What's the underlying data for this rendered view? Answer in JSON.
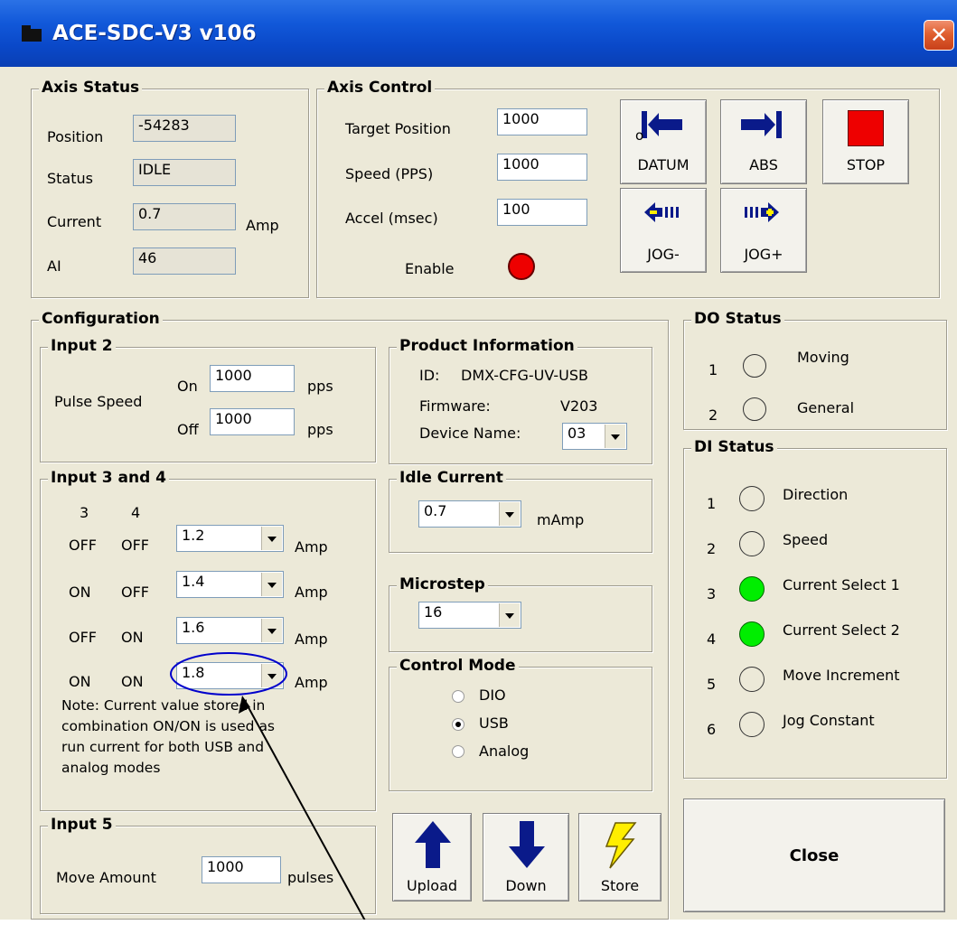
{
  "window": {
    "title": "ACE-SDC-V3 v106",
    "close_glyph": "✕"
  },
  "axis_status": {
    "title": "Axis Status",
    "position_label": "Position",
    "position_value": "-54283",
    "status_label": "Status",
    "status_value": "IDLE",
    "current_label": "Current",
    "current_value": "0.7",
    "current_unit": "Amp",
    "ai_label": "AI",
    "ai_value": "46"
  },
  "axis_control": {
    "title": "Axis Control",
    "target_label": "Target Position",
    "target_value": "1000",
    "speed_label": "Speed (PPS)",
    "speed_value": "1000",
    "accel_label": "Accel (msec)",
    "accel_value": "100",
    "enable_label": "Enable",
    "enable_color": "#ee0000",
    "datum_label": "DATUM",
    "datum_mark": "o",
    "abs_label": "ABS",
    "stop_label": "STOP",
    "jog_minus_label": "JOG-",
    "jog_plus_label": "JOG+"
  },
  "configuration": {
    "title": "Configuration",
    "input2": {
      "title": "Input 2",
      "pulse_speed_label": "Pulse Speed",
      "on_label": "On",
      "on_value": "1000",
      "on_unit": "pps",
      "off_label": "Off",
      "off_value": "1000",
      "off_unit": "pps"
    },
    "input34": {
      "title": "Input 3 and 4",
      "col3": "3",
      "col4": "4",
      "rows": [
        {
          "s3": "OFF",
          "s4": "OFF",
          "value": "1.2",
          "unit": "Amp"
        },
        {
          "s3": "ON",
          "s4": "OFF",
          "value": "1.4",
          "unit": "Amp"
        },
        {
          "s3": "OFF",
          "s4": "ON",
          "value": "1.6",
          "unit": "Amp"
        },
        {
          "s3": "ON",
          "s4": "ON",
          "value": "1.8",
          "unit": "Amp"
        }
      ],
      "note": [
        "Note: Current value stored in",
        "combination ON/ON is used as",
        "run current for both USB and",
        "analog modes"
      ]
    },
    "input5": {
      "title": "Input 5",
      "move_label": "Move Amount",
      "move_value": "1000",
      "move_unit": "pulses"
    },
    "product": {
      "title": "Product Information",
      "id_label": "ID:",
      "id_value": "DMX-CFG-UV-USB",
      "fw_label": "Firmware:",
      "fw_value": "V203",
      "device_label": "Device Name:",
      "device_value": "03"
    },
    "idle_current": {
      "title": "Idle Current",
      "value": "0.7",
      "unit": "mAmp"
    },
    "microstep": {
      "title": "Microstep",
      "value": "16"
    },
    "control_mode": {
      "title": "Control Mode",
      "options": [
        "DIO",
        "USB",
        "Analog"
      ],
      "selected": "USB"
    },
    "upload_label": "Upload",
    "down_label": "Down",
    "store_label": "Store"
  },
  "do_status": {
    "title": "DO Status",
    "items": [
      {
        "num": "1",
        "label": "Moving",
        "on": false
      },
      {
        "num": "2",
        "label": "General",
        "on": false
      }
    ]
  },
  "di_status": {
    "title": "DI Status",
    "items": [
      {
        "num": "1",
        "label": "Direction",
        "on": false
      },
      {
        "num": "2",
        "label": "Speed",
        "on": false
      },
      {
        "num": "3",
        "label": "Current Select 1",
        "on": true
      },
      {
        "num": "4",
        "label": "Current Select 2",
        "on": true
      },
      {
        "num": "5",
        "label": "Move Increment",
        "on": false
      },
      {
        "num": "6",
        "label": "Jog Constant",
        "on": false
      }
    ]
  },
  "close_label": "Close",
  "colors": {
    "led_on": "#00ee00",
    "stop_red": "#ee0000",
    "arrow_blue": "#0a1a8a",
    "store_yellow": "#ffee00",
    "annotation_blue": "#0000cc"
  }
}
